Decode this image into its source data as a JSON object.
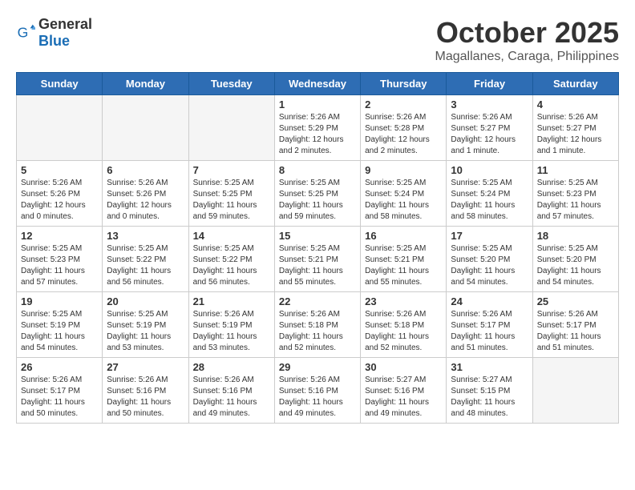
{
  "logo": {
    "general": "General",
    "blue": "Blue"
  },
  "title": "October 2025",
  "subtitle": "Magallanes, Caraga, Philippines",
  "headers": [
    "Sunday",
    "Monday",
    "Tuesday",
    "Wednesday",
    "Thursday",
    "Friday",
    "Saturday"
  ],
  "weeks": [
    [
      {
        "day": "",
        "info": ""
      },
      {
        "day": "",
        "info": ""
      },
      {
        "day": "",
        "info": ""
      },
      {
        "day": "1",
        "info": "Sunrise: 5:26 AM\nSunset: 5:29 PM\nDaylight: 12 hours\nand 2 minutes."
      },
      {
        "day": "2",
        "info": "Sunrise: 5:26 AM\nSunset: 5:28 PM\nDaylight: 12 hours\nand 2 minutes."
      },
      {
        "day": "3",
        "info": "Sunrise: 5:26 AM\nSunset: 5:27 PM\nDaylight: 12 hours\nand 1 minute."
      },
      {
        "day": "4",
        "info": "Sunrise: 5:26 AM\nSunset: 5:27 PM\nDaylight: 12 hours\nand 1 minute."
      }
    ],
    [
      {
        "day": "5",
        "info": "Sunrise: 5:26 AM\nSunset: 5:26 PM\nDaylight: 12 hours\nand 0 minutes."
      },
      {
        "day": "6",
        "info": "Sunrise: 5:26 AM\nSunset: 5:26 PM\nDaylight: 12 hours\nand 0 minutes."
      },
      {
        "day": "7",
        "info": "Sunrise: 5:25 AM\nSunset: 5:25 PM\nDaylight: 11 hours\nand 59 minutes."
      },
      {
        "day": "8",
        "info": "Sunrise: 5:25 AM\nSunset: 5:25 PM\nDaylight: 11 hours\nand 59 minutes."
      },
      {
        "day": "9",
        "info": "Sunrise: 5:25 AM\nSunset: 5:24 PM\nDaylight: 11 hours\nand 58 minutes."
      },
      {
        "day": "10",
        "info": "Sunrise: 5:25 AM\nSunset: 5:24 PM\nDaylight: 11 hours\nand 58 minutes."
      },
      {
        "day": "11",
        "info": "Sunrise: 5:25 AM\nSunset: 5:23 PM\nDaylight: 11 hours\nand 57 minutes."
      }
    ],
    [
      {
        "day": "12",
        "info": "Sunrise: 5:25 AM\nSunset: 5:23 PM\nDaylight: 11 hours\nand 57 minutes."
      },
      {
        "day": "13",
        "info": "Sunrise: 5:25 AM\nSunset: 5:22 PM\nDaylight: 11 hours\nand 56 minutes."
      },
      {
        "day": "14",
        "info": "Sunrise: 5:25 AM\nSunset: 5:22 PM\nDaylight: 11 hours\nand 56 minutes."
      },
      {
        "day": "15",
        "info": "Sunrise: 5:25 AM\nSunset: 5:21 PM\nDaylight: 11 hours\nand 55 minutes."
      },
      {
        "day": "16",
        "info": "Sunrise: 5:25 AM\nSunset: 5:21 PM\nDaylight: 11 hours\nand 55 minutes."
      },
      {
        "day": "17",
        "info": "Sunrise: 5:25 AM\nSunset: 5:20 PM\nDaylight: 11 hours\nand 54 minutes."
      },
      {
        "day": "18",
        "info": "Sunrise: 5:25 AM\nSunset: 5:20 PM\nDaylight: 11 hours\nand 54 minutes."
      }
    ],
    [
      {
        "day": "19",
        "info": "Sunrise: 5:25 AM\nSunset: 5:19 PM\nDaylight: 11 hours\nand 54 minutes."
      },
      {
        "day": "20",
        "info": "Sunrise: 5:25 AM\nSunset: 5:19 PM\nDaylight: 11 hours\nand 53 minutes."
      },
      {
        "day": "21",
        "info": "Sunrise: 5:26 AM\nSunset: 5:19 PM\nDaylight: 11 hours\nand 53 minutes."
      },
      {
        "day": "22",
        "info": "Sunrise: 5:26 AM\nSunset: 5:18 PM\nDaylight: 11 hours\nand 52 minutes."
      },
      {
        "day": "23",
        "info": "Sunrise: 5:26 AM\nSunset: 5:18 PM\nDaylight: 11 hours\nand 52 minutes."
      },
      {
        "day": "24",
        "info": "Sunrise: 5:26 AM\nSunset: 5:17 PM\nDaylight: 11 hours\nand 51 minutes."
      },
      {
        "day": "25",
        "info": "Sunrise: 5:26 AM\nSunset: 5:17 PM\nDaylight: 11 hours\nand 51 minutes."
      }
    ],
    [
      {
        "day": "26",
        "info": "Sunrise: 5:26 AM\nSunset: 5:17 PM\nDaylight: 11 hours\nand 50 minutes."
      },
      {
        "day": "27",
        "info": "Sunrise: 5:26 AM\nSunset: 5:16 PM\nDaylight: 11 hours\nand 50 minutes."
      },
      {
        "day": "28",
        "info": "Sunrise: 5:26 AM\nSunset: 5:16 PM\nDaylight: 11 hours\nand 49 minutes."
      },
      {
        "day": "29",
        "info": "Sunrise: 5:26 AM\nSunset: 5:16 PM\nDaylight: 11 hours\nand 49 minutes."
      },
      {
        "day": "30",
        "info": "Sunrise: 5:27 AM\nSunset: 5:16 PM\nDaylight: 11 hours\nand 49 minutes."
      },
      {
        "day": "31",
        "info": "Sunrise: 5:27 AM\nSunset: 5:15 PM\nDaylight: 11 hours\nand 48 minutes."
      },
      {
        "day": "",
        "info": ""
      }
    ]
  ]
}
